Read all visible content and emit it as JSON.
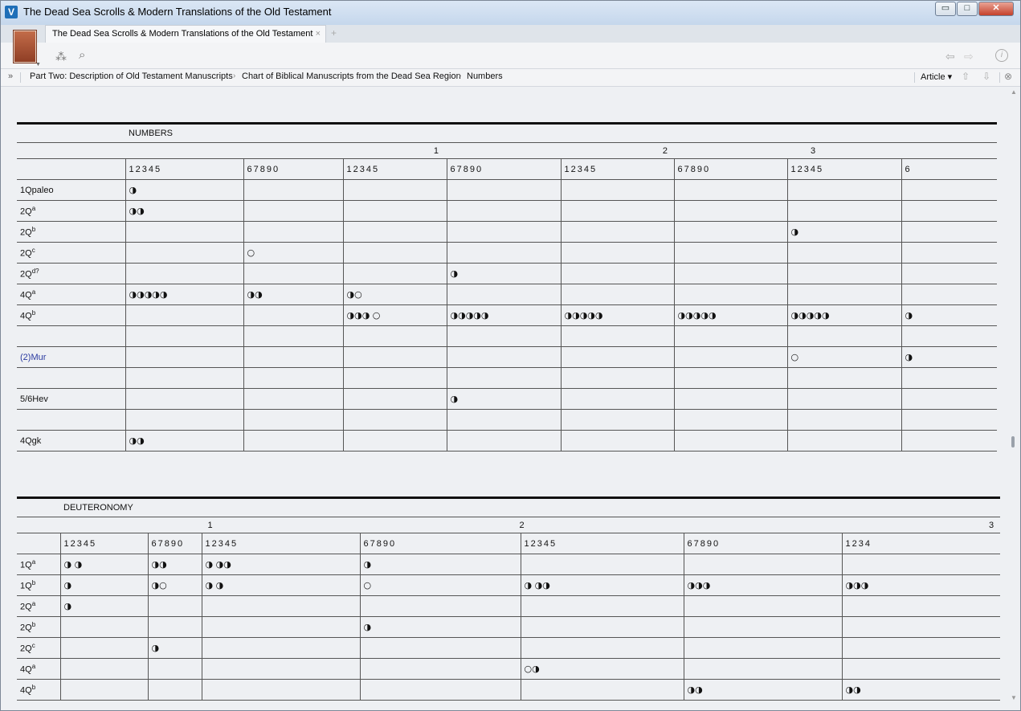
{
  "window": {
    "title": "The Dead Sea Scrolls & Modern Translations of the Old Testament"
  },
  "tab": {
    "title": "The Dead Sea Scrolls & Modern Translations of the Old Testament",
    "close": "×",
    "new": "+"
  },
  "window_buttons": {
    "minimize": "▭",
    "maximize": "□",
    "close": "✕"
  },
  "toolbar": {
    "panels_icon": "⁂",
    "search_icon": "⌕",
    "back_icon": "⇦",
    "forward_icon": "⇨",
    "info_icon": "i"
  },
  "breadcrumbs": {
    "chevrons": "»",
    "items": [
      "Part Two: Description of Old Testament Manuscripts",
      "Chart of Biblical Manuscripts from the Dead Sea Region",
      "Numbers"
    ],
    "separator": "›",
    "article_label": "Article ▾",
    "up_icon": "⇧",
    "down_icon": "⇩",
    "close_icon": "⊗"
  },
  "numbers": {
    "title": "NUMBERS",
    "chapter_tens": [
      "1",
      "2",
      "3"
    ],
    "headers": [
      "12345",
      "67890",
      "12345",
      "67890",
      "12345",
      "67890",
      "12345",
      "6"
    ],
    "rows": [
      {
        "label": "1Qpaleo",
        "sup": "",
        "cells": [
          "◑",
          "",
          "",
          "",
          "",
          "",
          "",
          ""
        ]
      },
      {
        "label": "2Q",
        "sup": "a",
        "cells": [
          "◑◑",
          "",
          "",
          "",
          "",
          "",
          "",
          ""
        ]
      },
      {
        "label": "2Q",
        "sup": "b",
        "cells": [
          "",
          "",
          "",
          "",
          "",
          "",
          "◑",
          ""
        ]
      },
      {
        "label": "2Q",
        "sup": "c",
        "cells": [
          "",
          "○",
          "",
          "",
          "",
          "",
          "",
          ""
        ]
      },
      {
        "label": "2Q",
        "sup": "d?",
        "cells": [
          "",
          "",
          "",
          "◑",
          "",
          "",
          "",
          ""
        ]
      },
      {
        "label": "4Q",
        "sup": "a",
        "cells": [
          "◑◑◑◑◑",
          "◑◑",
          "◑○",
          "",
          "",
          "",
          "",
          ""
        ]
      },
      {
        "label": "4Q",
        "sup": "b",
        "cells": [
          "",
          "",
          "◑◑◑ ○",
          "◑◑◑◑◑",
          "◑◑◑◑◑",
          "◑◑◑◑◑",
          "◑◑◑◑◑",
          "◑"
        ]
      },
      {
        "label": "",
        "sup": "",
        "cells": [
          "",
          "",
          "",
          "",
          "",
          "",
          "",
          ""
        ]
      },
      {
        "label": "(2)Mur",
        "sup": "",
        "link": true,
        "cells": [
          "",
          "",
          "",
          "",
          "",
          "",
          "○",
          "◑"
        ]
      },
      {
        "label": "",
        "sup": "",
        "cells": [
          "",
          "",
          "",
          "",
          "",
          "",
          "",
          ""
        ]
      },
      {
        "label": "5/6Hev",
        "sup": "",
        "cells": [
          "",
          "",
          "",
          "◑",
          "",
          "",
          "",
          ""
        ]
      },
      {
        "label": "",
        "sup": "",
        "cells": [
          "",
          "",
          "",
          "",
          "",
          "",
          "",
          ""
        ]
      },
      {
        "label": "4Qgk",
        "sup": "",
        "cells": [
          "◑◑",
          "",
          "",
          "",
          "",
          "",
          "",
          ""
        ]
      }
    ]
  },
  "deuteronomy": {
    "title": "DEUTERONOMY",
    "chapter_tens": [
      "1",
      "2",
      "3"
    ],
    "headers": [
      "12345",
      "67890",
      "12345",
      "67890",
      "12345",
      "67890",
      "1234"
    ],
    "rows": [
      {
        "label": "1Q",
        "sup": "a",
        "cells": [
          "◑ ◑",
          "◑◑",
          "◑ ◑◑",
          "◑",
          "",
          "",
          ""
        ]
      },
      {
        "label": "1Q",
        "sup": "b",
        "cells": [
          "◑",
          "◑○",
          "◑ ◑",
          "○",
          "◑ ◑◑",
          "◑◑◑",
          "◑◑◑"
        ]
      },
      {
        "label": "2Q",
        "sup": "a",
        "cells": [
          "◑",
          "",
          "",
          "",
          "",
          "",
          ""
        ]
      },
      {
        "label": "2Q",
        "sup": "b",
        "cells": [
          "",
          "",
          "",
          "◑",
          "",
          "",
          ""
        ]
      },
      {
        "label": "2Q",
        "sup": "c",
        "cells": [
          "",
          "◑",
          "",
          "",
          "",
          "",
          ""
        ]
      },
      {
        "label": "4Q",
        "sup": "a",
        "cells": [
          "",
          "",
          "",
          "",
          "○◑",
          "",
          ""
        ]
      },
      {
        "label": "4Q",
        "sup": "b",
        "cells": [
          "",
          "",
          "",
          "",
          "",
          "◑◑",
          "◑◑"
        ]
      }
    ]
  }
}
